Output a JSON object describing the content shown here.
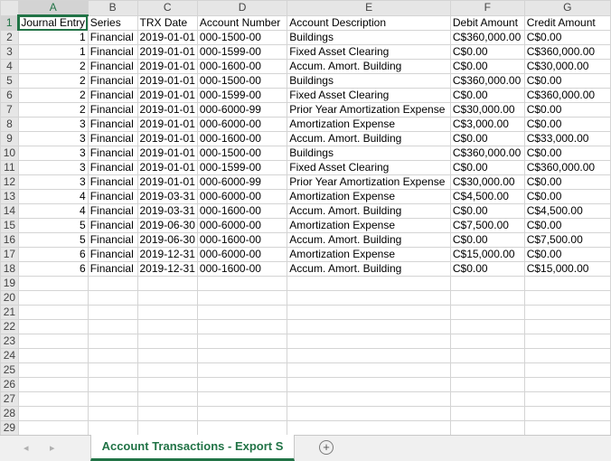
{
  "columns": [
    "A",
    "B",
    "C",
    "D",
    "E",
    "F",
    "G"
  ],
  "header_row": [
    "Journal Entry",
    "Series",
    "TRX Date",
    "Account Number",
    "Account Description",
    "Debit Amount",
    "Credit Amount"
  ],
  "rows": [
    [
      "1",
      "Financial",
      "2019-01-01",
      "000-1500-00",
      "Buildings",
      "C$360,000.00",
      "C$0.00"
    ],
    [
      "1",
      "Financial",
      "2019-01-01",
      "000-1599-00",
      "Fixed Asset Clearing",
      "C$0.00",
      "C$360,000.00"
    ],
    [
      "2",
      "Financial",
      "2019-01-01",
      "000-1600-00",
      "Accum. Amort. Building",
      "C$0.00",
      "C$30,000.00"
    ],
    [
      "2",
      "Financial",
      "2019-01-01",
      "000-1500-00",
      "Buildings",
      "C$360,000.00",
      "C$0.00"
    ],
    [
      "2",
      "Financial",
      "2019-01-01",
      "000-1599-00",
      "Fixed Asset Clearing",
      "C$0.00",
      "C$360,000.00"
    ],
    [
      "2",
      "Financial",
      "2019-01-01",
      "000-6000-99",
      "Prior Year Amortization Expense",
      "C$30,000.00",
      "C$0.00"
    ],
    [
      "3",
      "Financial",
      "2019-01-01",
      "000-6000-00",
      "Amortization Expense",
      "C$3,000.00",
      "C$0.00"
    ],
    [
      "3",
      "Financial",
      "2019-01-01",
      "000-1600-00",
      "Accum. Amort. Building",
      "C$0.00",
      "C$33,000.00"
    ],
    [
      "3",
      "Financial",
      "2019-01-01",
      "000-1500-00",
      "Buildings",
      "C$360,000.00",
      "C$0.00"
    ],
    [
      "3",
      "Financial",
      "2019-01-01",
      "000-1599-00",
      "Fixed Asset Clearing",
      "C$0.00",
      "C$360,000.00"
    ],
    [
      "3",
      "Financial",
      "2019-01-01",
      "000-6000-99",
      "Prior Year Amortization Expense",
      "C$30,000.00",
      "C$0.00"
    ],
    [
      "4",
      "Financial",
      "2019-03-31",
      "000-6000-00",
      "Amortization Expense",
      "C$4,500.00",
      "C$0.00"
    ],
    [
      "4",
      "Financial",
      "2019-03-31",
      "000-1600-00",
      "Accum. Amort. Building",
      "C$0.00",
      "C$4,500.00"
    ],
    [
      "5",
      "Financial",
      "2019-06-30",
      "000-6000-00",
      "Amortization Expense",
      "C$7,500.00",
      "C$0.00"
    ],
    [
      "5",
      "Financial",
      "2019-06-30",
      "000-1600-00",
      "Accum. Amort. Building",
      "C$0.00",
      "C$7,500.00"
    ],
    [
      "6",
      "Financial",
      "2019-12-31",
      "000-6000-00",
      "Amortization Expense",
      "C$15,000.00",
      "C$0.00"
    ],
    [
      "6",
      "Financial",
      "2019-12-31",
      "000-1600-00",
      "Accum. Amort. Building",
      "C$0.00",
      "C$15,000.00"
    ]
  ],
  "empty_row_numbers": [
    "19",
    "20",
    "21",
    "22",
    "23",
    "24",
    "25",
    "26",
    "27",
    "28",
    "29"
  ],
  "sheet_tab": {
    "label": "Account Transactions - Export S"
  },
  "tabbar": {
    "prev_icon": "◂",
    "next_icon": "▸",
    "add_icon": "+"
  },
  "colors": {
    "accent": "#217346",
    "header_bg": "#e6e6e6",
    "grid_line": "#d4d4d4"
  }
}
